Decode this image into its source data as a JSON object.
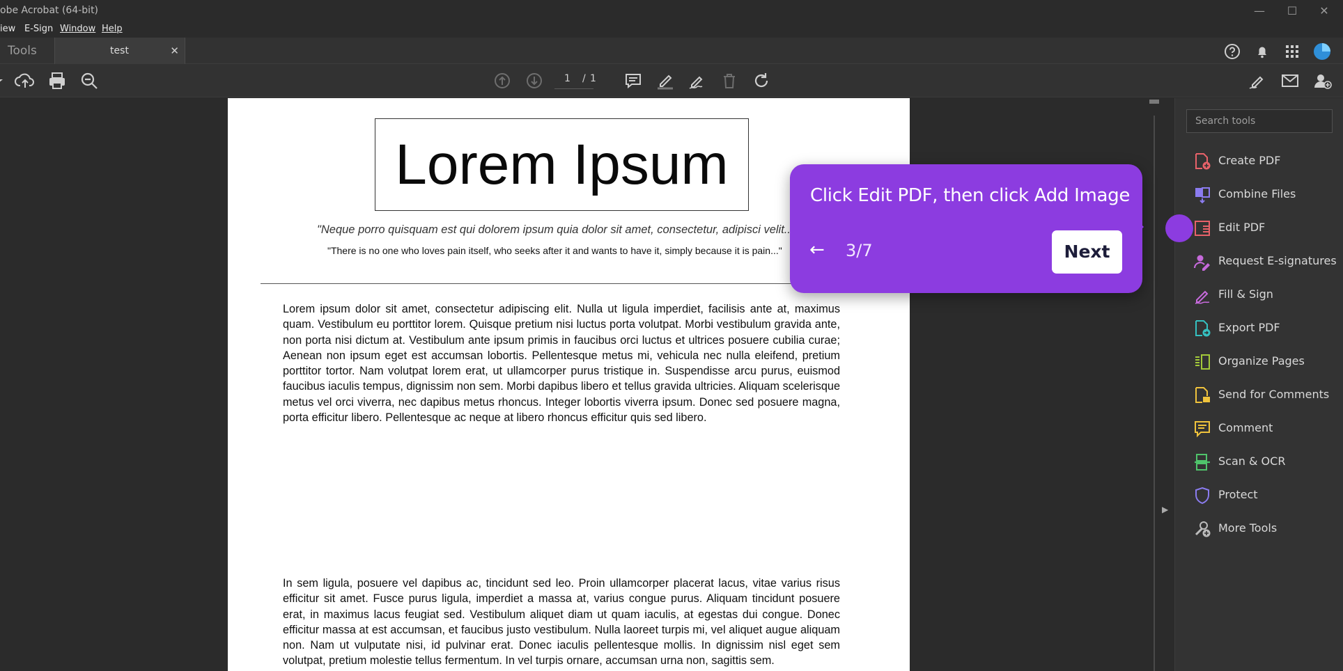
{
  "window": {
    "title": "obe Acrobat (64-bit)",
    "controls": [
      "—",
      "☐",
      "✕"
    ]
  },
  "menu": [
    "iew",
    "E-Sign",
    "Window",
    "Help"
  ],
  "tabs": {
    "tools": "Tools",
    "doc": "test",
    "close": "✕"
  },
  "toolbar": {
    "page_current": "1",
    "page_sep": "/",
    "page_total": "1"
  },
  "document": {
    "title": "Lorem Ipsum",
    "quote1": "\"Neque porro quisquam est qui dolorem ipsum quia dolor sit amet, consectetur, adipisci velit...\"",
    "quote2": "\"There is no one who loves pain itself, who seeks after it and wants to have it, simply because it is pain...\"",
    "para1": "Lorem ipsum dolor sit amet, consectetur adipiscing elit. Nulla ut ligula imperdiet, facilisis ante at, maximus quam. Vestibulum eu porttitor lorem. Quisque pretium nisi luctus porta volutpat. Morbi vestibulum gravida ante, non porta nisi dictum at. Vestibulum ante ipsum primis in faucibus orci luctus et ultrices posuere cubilia curae; Aenean non ipsum eget est accumsan lobortis. Pellentesque metus mi, vehicula nec nulla eleifend, pretium porttitor tortor. Nam volutpat lorem erat, ut ullamcorper purus tristique in. Suspendisse arcu purus, euismod faucibus iaculis tempus, dignissim non sem. Morbi dapibus libero et tellus gravida ultricies. Aliquam scelerisque metus vel orci viverra, nec dapibus metus rhoncus. Integer lobortis viverra ipsum. Donec sed posuere magna, porta efficitur libero. Pellentesque ac neque at libero rhoncus efficitur quis sed libero.",
    "para2": "In sem ligula, posuere vel dapibus ac, tincidunt sed leo. Proin ullamcorper placerat lacus, vitae varius risus efficitur sit amet. Fusce purus ligula, imperdiet a massa at, varius congue purus. Aliquam tincidunt posuere erat, in maximus lacus feugiat sed. Vestibulum aliquet diam ut quam iaculis, at egestas dui congue. Donec efficitur massa at est accumsan, et faucibus justo vestibulum. Nulla laoreet turpis mi, vel aliquet augue aliquam non. Nam ut vulputate nisi, id pulvinar erat. Donec iaculis pellentesque mollis. In dignissim nisl eget sem volutpat, pretium molestie tellus fermentum. In vel turpis ornare, accumsan urna non, sagittis sem."
  },
  "right_pane": {
    "search_placeholder": "Search tools",
    "tools": [
      {
        "label": "Create PDF",
        "icon": "create-pdf-icon",
        "color": "#e8626a"
      },
      {
        "label": "Combine Files",
        "icon": "combine-files-icon",
        "color": "#8b7cf0"
      },
      {
        "label": "Edit PDF",
        "icon": "edit-pdf-icon",
        "color": "#e8626a"
      },
      {
        "label": "Request E-signatures",
        "icon": "request-esign-icon",
        "color": "#c66adb"
      },
      {
        "label": "Fill & Sign",
        "icon": "fill-sign-icon",
        "color": "#c66adb"
      },
      {
        "label": "Export PDF",
        "icon": "export-pdf-icon",
        "color": "#35c1c1"
      },
      {
        "label": "Organize Pages",
        "icon": "organize-pages-icon",
        "color": "#a3c93a"
      },
      {
        "label": "Send for Comments",
        "icon": "send-comments-icon",
        "color": "#f0c33c"
      },
      {
        "label": "Comment",
        "icon": "comment-icon",
        "color": "#f0c33c"
      },
      {
        "label": "Scan & OCR",
        "icon": "scan-ocr-icon",
        "color": "#4fc46b"
      },
      {
        "label": "Protect",
        "icon": "protect-icon",
        "color": "#8b7cf0"
      },
      {
        "label": "More Tools",
        "icon": "more-tools-icon",
        "color": "#bdbdbd"
      }
    ]
  },
  "coachmark": {
    "message": "Click Edit PDF, then click Add Image",
    "back": "←",
    "step": "3/7",
    "next": "Next",
    "accent": "#8c3ce0"
  }
}
